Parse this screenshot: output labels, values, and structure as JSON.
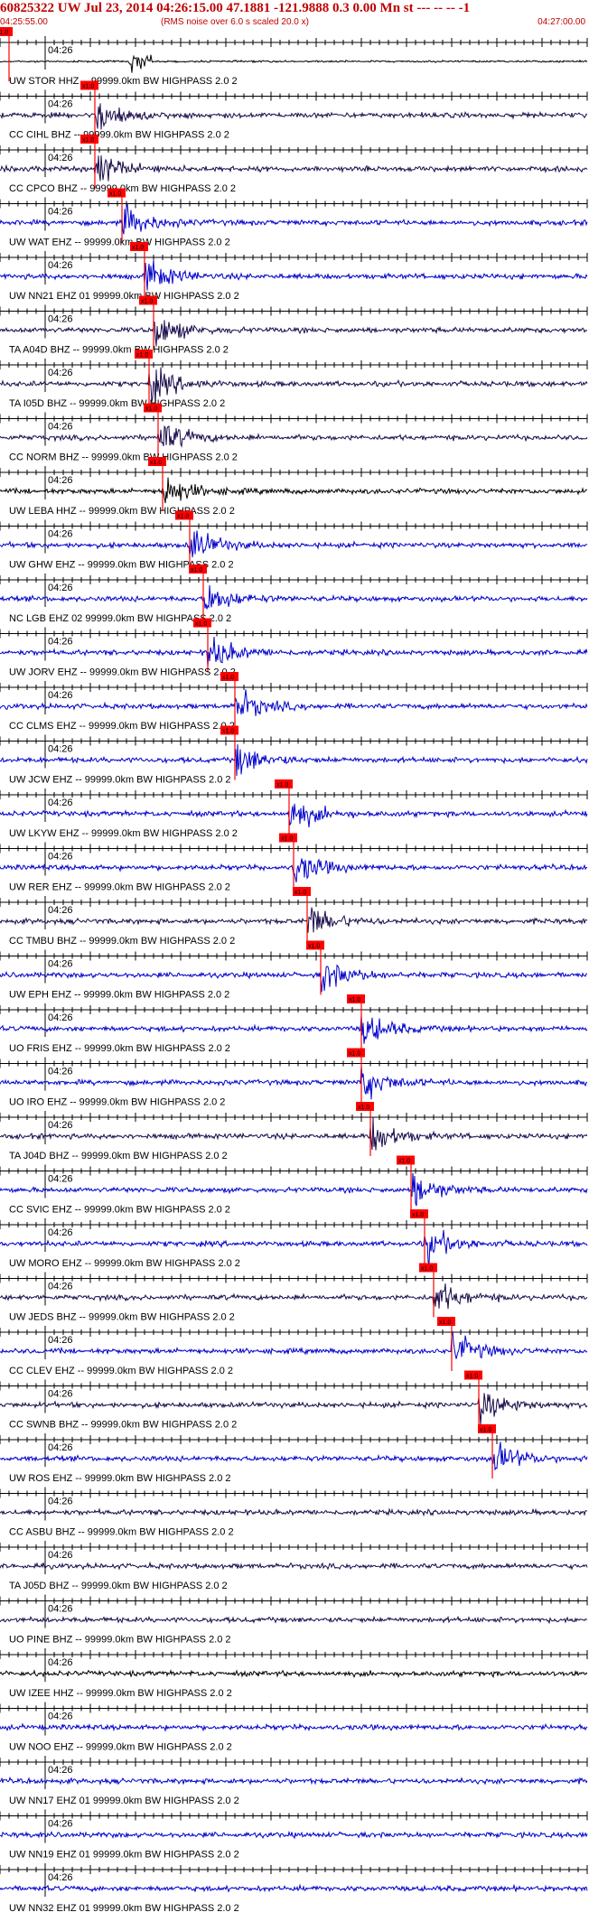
{
  "header": {
    "title": "60825322 UW Jul 23, 2014 04:26:15.00   47.1881 -121.9888  0.3 0.00 Mn st --- -- --  -1",
    "start_time": "04:25:55.00",
    "noise_note": "(RMS noise over 6.0 s scaled 20.0 x)",
    "end_time": "04:27:00.00"
  },
  "chart_data": {
    "type": "line",
    "title": "60825322 UW Jul 23, 2014 04:26:15.00   47.1881 -121.9888  0.3 0.00 Mn st --- -- --  -1",
    "x_axis": {
      "start": "04:25:55.00",
      "end": "04:27:00.00",
      "minute_label": "04:26"
    },
    "pick_label": "x1.0",
    "traces": [
      {
        "label": "UW STOR HHZ -- 99999.0km BW  HIGHPASS  2.0  2",
        "color": "#000000",
        "pick_s": 1.0
      },
      {
        "label": "CC CIHL BHZ -- 99999.0km BW  HIGHPASS  2.0  2",
        "color": "#1a0a4a",
        "pick_s": 10.5
      },
      {
        "label": "CC CPCO BHZ -- 99999.0km BW  HIGHPASS  2.0  2",
        "color": "#1a0a4a",
        "pick_s": 10.5
      },
      {
        "label": "UW WAT EHZ -- 99999.0km BW  HIGHPASS  2.0  2",
        "color": "#0000cc",
        "pick_s": 13.5
      },
      {
        "label": "UW NN21 EHZ 01 99999.0km BW  HIGHPASS  2.0  2",
        "color": "#0000cc",
        "pick_s": 16.0
      },
      {
        "label": "TA A04D BHZ -- 99999.0km BW  HIGHPASS  2.0  2",
        "color": "#1a0a4a",
        "pick_s": 17.0
      },
      {
        "label": "TA I05D BHZ -- 99999.0km BW  HIGHPASS  2.0  2",
        "color": "#1a0a4a",
        "pick_s": 16.5
      },
      {
        "label": "CC NORM BHZ -- 99999.0km BW  HIGHPASS  2.0  2",
        "color": "#1a0a4a",
        "pick_s": 17.5
      },
      {
        "label": "UW LEBA HHZ -- 99999.0km BW  HIGHPASS  2.0  2",
        "color": "#000000",
        "pick_s": 18.0
      },
      {
        "label": "UW GHW EHZ -- 99999.0km BW  HIGHPASS  2.0  2",
        "color": "#0000cc",
        "pick_s": 21.0
      },
      {
        "label": "NC LGB EHZ 02 99999.0km BW  HIGHPASS  2.0  2",
        "color": "#0000cc",
        "pick_s": 22.5
      },
      {
        "label": "UW JORV EHZ -- 99999.0km BW  HIGHPASS  2.0  2",
        "color": "#0000cc",
        "pick_s": 23.0
      },
      {
        "label": "CC CLMS EHZ -- 99999.0km BW  HIGHPASS  2.0  2",
        "color": "#0000cc",
        "pick_s": 26.0
      },
      {
        "label": "UW JCW EHZ -- 99999.0km BW  HIGHPASS  2.0  2",
        "color": "#0000cc",
        "pick_s": 26.0
      },
      {
        "label": "UW LKYW EHZ -- 99999.0km BW  HIGHPASS  2.0  2",
        "color": "#0000cc",
        "pick_s": 32.0
      },
      {
        "label": "UW RER EHZ -- 99999.0km BW  HIGHPASS  2.0  2",
        "color": "#0000cc",
        "pick_s": 32.5
      },
      {
        "label": "CC TMBU BHZ -- 99999.0km BW  HIGHPASS  2.0  2",
        "color": "#1a0a4a",
        "pick_s": 34.0
      },
      {
        "label": "UW EPH EHZ -- 99999.0km BW  HIGHPASS  2.0  2",
        "color": "#0000cc",
        "pick_s": 35.5
      },
      {
        "label": "UO FRIS EHZ -- 99999.0km BW  HIGHPASS  2.0  2",
        "color": "#0000cc",
        "pick_s": 40.0
      },
      {
        "label": "UO IRO EHZ -- 99999.0km BW  HIGHPASS  2.0  2",
        "color": "#0000cc",
        "pick_s": 40.0
      },
      {
        "label": "TA J04D BHZ -- 99999.0km BW  HIGHPASS  2.0  2",
        "color": "#1a0a4a",
        "pick_s": 41.0
      },
      {
        "label": "CC SVIC EHZ -- 99999.0km BW  HIGHPASS  2.0  2",
        "color": "#0000cc",
        "pick_s": 45.5
      },
      {
        "label": "UW MORO EHZ -- 99999.0km BW  HIGHPASS  2.0  2",
        "color": "#0000cc",
        "pick_s": 47.0
      },
      {
        "label": "UW JEDS BHZ -- 99999.0km BW  HIGHPASS  2.0  2",
        "color": "#1a0a4a",
        "pick_s": 48.0
      },
      {
        "label": "CC CLEV EHZ -- 99999.0km BW  HIGHPASS  2.0  2",
        "color": "#0000cc",
        "pick_s": 50.0
      },
      {
        "label": "CC SWNB BHZ -- 99999.0km BW  HIGHPASS  2.0  2",
        "color": "#1a0a4a",
        "pick_s": 53.0
      },
      {
        "label": "UW ROS EHZ -- 99999.0km BW  HIGHPASS  2.0  2",
        "color": "#0000cc",
        "pick_s": 54.5
      },
      {
        "label": "CC ASBU BHZ -- 99999.0km BW  HIGHPASS  2.0  2",
        "color": "#1a0a4a",
        "pick_s": null
      },
      {
        "label": "TA J05D BHZ -- 99999.0km BW  HIGHPASS  2.0  2",
        "color": "#1a0a4a",
        "pick_s": null
      },
      {
        "label": "UO PINE BHZ -- 99999.0km BW  HIGHPASS  2.0  2",
        "color": "#1a0a4a",
        "pick_s": null
      },
      {
        "label": "UW IZEE HHZ -- 99999.0km BW  HIGHPASS  2.0  2",
        "color": "#000000",
        "pick_s": null
      },
      {
        "label": "UW NOO EHZ -- 99999.0km BW  HIGHPASS  2.0  2",
        "color": "#0000cc",
        "pick_s": null
      },
      {
        "label": "UW NN17 EHZ 01 99999.0km BW  HIGHPASS  2.0  2",
        "color": "#0000cc",
        "pick_s": null
      },
      {
        "label": "UW NN19 EHZ 01 99999.0km BW  HIGHPASS  2.0  2",
        "color": "#0000cc",
        "pick_s": null
      },
      {
        "label": "UW NN32 EHZ 01 99999.0km BW  HIGHPASS  2.0  2",
        "color": "#0000cc",
        "pick_s": null
      }
    ]
  }
}
